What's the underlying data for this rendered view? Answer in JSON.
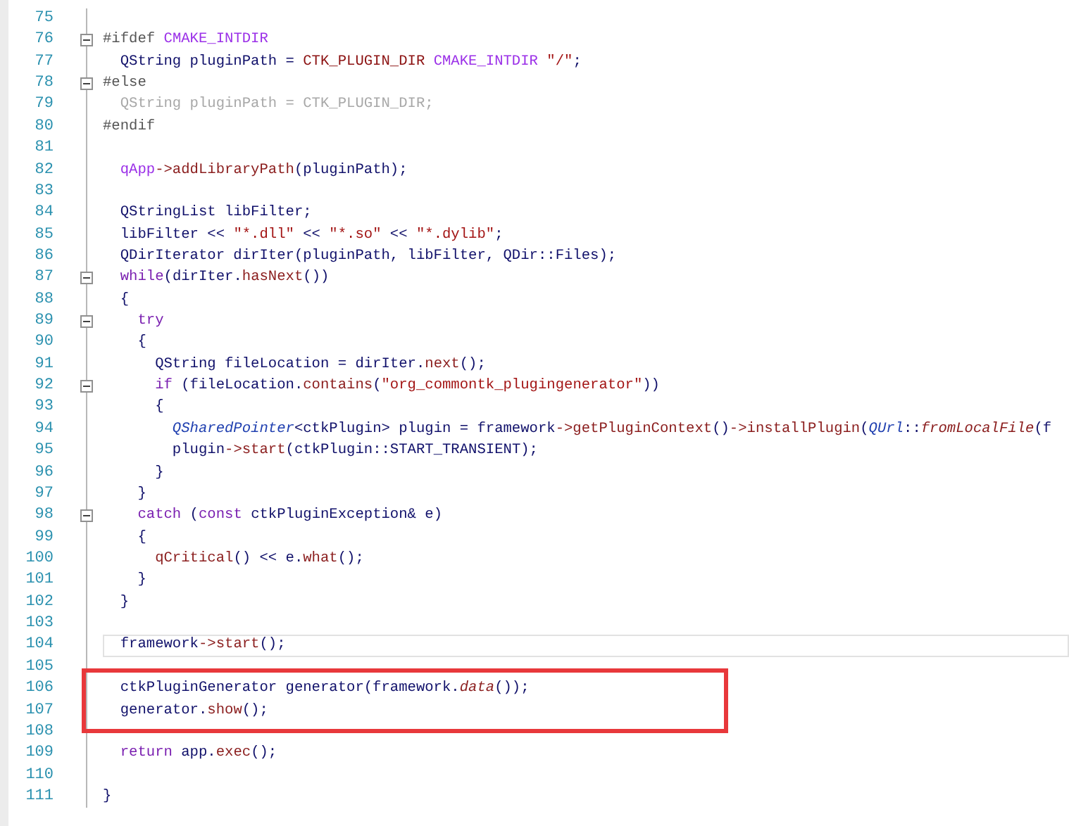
{
  "editor": {
    "lines": [
      {
        "number": "75",
        "collapsible": false,
        "current": false,
        "boxed": false
      },
      {
        "number": "76",
        "collapsible": true,
        "current": false,
        "boxed": false,
        "tokens": [
          {
            "kind": "preproc",
            "text": "#ifdef "
          },
          {
            "kind": "macro",
            "text": "CMAKE_INTDIR"
          }
        ]
      },
      {
        "number": "77",
        "collapsible": false,
        "current": false,
        "boxed": false,
        "tokens": [
          {
            "kind": "plain",
            "text": "  QString pluginPath = "
          },
          {
            "kind": "constant",
            "text": "CTK_PLUGIN_DIR "
          },
          {
            "kind": "macro",
            "text": "CMAKE_INTDIR "
          },
          {
            "kind": "string",
            "text": "\"/\""
          },
          {
            "kind": "plain",
            "text": ";"
          }
        ]
      },
      {
        "number": "78",
        "collapsible": true,
        "current": false,
        "boxed": false,
        "tokens": [
          {
            "kind": "preproc",
            "text": "#else"
          }
        ]
      },
      {
        "number": "79",
        "collapsible": false,
        "current": false,
        "boxed": false,
        "tokens": [
          {
            "kind": "inactive",
            "text": "  QString pluginPath = CTK_PLUGIN_DIR;"
          }
        ]
      },
      {
        "number": "80",
        "collapsible": false,
        "current": false,
        "boxed": false,
        "tokens": [
          {
            "kind": "preproc",
            "text": "#endif"
          }
        ]
      },
      {
        "number": "81",
        "collapsible": false,
        "current": false,
        "boxed": false
      },
      {
        "number": "82",
        "collapsible": false,
        "current": false,
        "boxed": false,
        "tokens": [
          {
            "kind": "macro",
            "text": "  qApp"
          },
          {
            "kind": "function",
            "text": "->addLibraryPath"
          },
          {
            "kind": "plain",
            "text": "(pluginPath);"
          }
        ]
      },
      {
        "number": "83",
        "collapsible": false,
        "current": false,
        "boxed": false
      },
      {
        "number": "84",
        "collapsible": false,
        "current": false,
        "boxed": false,
        "tokens": [
          {
            "kind": "plain",
            "text": "  QStringList libFilter;"
          }
        ]
      },
      {
        "number": "85",
        "collapsible": false,
        "current": false,
        "boxed": false,
        "tokens": [
          {
            "kind": "plain",
            "text": "  libFilter << "
          },
          {
            "kind": "string",
            "text": "\"*.dll\""
          },
          {
            "kind": "plain",
            "text": " << "
          },
          {
            "kind": "string",
            "text": "\"*.so\""
          },
          {
            "kind": "plain",
            "text": " << "
          },
          {
            "kind": "string",
            "text": "\"*.dylib\""
          },
          {
            "kind": "plain",
            "text": ";"
          }
        ]
      },
      {
        "number": "86",
        "collapsible": false,
        "current": false,
        "boxed": false,
        "tokens": [
          {
            "kind": "plain",
            "text": "  QDirIterator dirIter(pluginPath, libFilter, QDir::Files);"
          }
        ]
      },
      {
        "number": "87",
        "collapsible": true,
        "current": false,
        "boxed": false,
        "tokens": [
          {
            "kind": "keyword",
            "text": "  while"
          },
          {
            "kind": "plain",
            "text": "(dirIter."
          },
          {
            "kind": "function",
            "text": "hasNext"
          },
          {
            "kind": "plain",
            "text": "())"
          }
        ]
      },
      {
        "number": "88",
        "collapsible": false,
        "current": false,
        "boxed": false,
        "tokens": [
          {
            "kind": "plain",
            "text": "  {"
          }
        ]
      },
      {
        "number": "89",
        "collapsible": true,
        "current": false,
        "boxed": false,
        "tokens": [
          {
            "kind": "keyword",
            "text": "    try"
          }
        ]
      },
      {
        "number": "90",
        "collapsible": false,
        "current": false,
        "boxed": false,
        "tokens": [
          {
            "kind": "plain",
            "text": "    {"
          }
        ]
      },
      {
        "number": "91",
        "collapsible": false,
        "current": false,
        "boxed": false,
        "tokens": [
          {
            "kind": "plain",
            "text": "      QString fileLocation = dirIter."
          },
          {
            "kind": "function",
            "text": "next"
          },
          {
            "kind": "plain",
            "text": "();"
          }
        ]
      },
      {
        "number": "92",
        "collapsible": true,
        "current": false,
        "boxed": false,
        "tokens": [
          {
            "kind": "keyword",
            "text": "      if"
          },
          {
            "kind": "plain",
            "text": " (fileLocation."
          },
          {
            "kind": "function",
            "text": "contains"
          },
          {
            "kind": "plain",
            "text": "("
          },
          {
            "kind": "string",
            "text": "\"org_commontk_plugingenerator\""
          },
          {
            "kind": "plain",
            "text": "))"
          }
        ]
      },
      {
        "number": "93",
        "collapsible": false,
        "current": false,
        "boxed": false,
        "tokens": [
          {
            "kind": "plain",
            "text": "      {"
          }
        ]
      },
      {
        "number": "94",
        "collapsible": false,
        "current": false,
        "boxed": false,
        "tokens": [
          {
            "kind": "type-italic",
            "text": "        QSharedPointer"
          },
          {
            "kind": "plain",
            "text": "<ctkPlugin> plugin = framework"
          },
          {
            "kind": "function",
            "text": "->getPluginContext"
          },
          {
            "kind": "plain",
            "text": "()"
          },
          {
            "kind": "function",
            "text": "->installPlugin"
          },
          {
            "kind": "plain",
            "text": "("
          },
          {
            "kind": "type-italic",
            "text": "QUrl"
          },
          {
            "kind": "plain",
            "text": "::"
          },
          {
            "kind": "function-italic",
            "text": "fromLocalFile"
          },
          {
            "kind": "plain",
            "text": "(f"
          }
        ]
      },
      {
        "number": "95",
        "collapsible": false,
        "current": false,
        "boxed": false,
        "tokens": [
          {
            "kind": "plain",
            "text": "        plugin"
          },
          {
            "kind": "function",
            "text": "->start"
          },
          {
            "kind": "plain",
            "text": "(ctkPlugin::START_TRANSIENT);"
          }
        ]
      },
      {
        "number": "96",
        "collapsible": false,
        "current": false,
        "boxed": false,
        "tokens": [
          {
            "kind": "plain",
            "text": "      }"
          }
        ]
      },
      {
        "number": "97",
        "collapsible": false,
        "current": false,
        "boxed": false,
        "tokens": [
          {
            "kind": "plain",
            "text": "    }"
          }
        ]
      },
      {
        "number": "98",
        "collapsible": true,
        "current": false,
        "boxed": false,
        "tokens": [
          {
            "kind": "keyword",
            "text": "    catch"
          },
          {
            "kind": "plain",
            "text": " ("
          },
          {
            "kind": "keyword",
            "text": "const"
          },
          {
            "kind": "plain",
            "text": " ctkPluginException& e)"
          }
        ]
      },
      {
        "number": "99",
        "collapsible": false,
        "current": false,
        "boxed": false,
        "tokens": [
          {
            "kind": "plain",
            "text": "    {"
          }
        ]
      },
      {
        "number": "100",
        "collapsible": false,
        "current": false,
        "boxed": false,
        "tokens": [
          {
            "kind": "function",
            "text": "      qCritical"
          },
          {
            "kind": "plain",
            "text": "() << e."
          },
          {
            "kind": "function",
            "text": "what"
          },
          {
            "kind": "plain",
            "text": "();"
          }
        ]
      },
      {
        "number": "101",
        "collapsible": false,
        "current": false,
        "boxed": false,
        "tokens": [
          {
            "kind": "plain",
            "text": "    }"
          }
        ]
      },
      {
        "number": "102",
        "collapsible": false,
        "current": false,
        "boxed": false,
        "tokens": [
          {
            "kind": "plain",
            "text": "  }"
          }
        ]
      },
      {
        "number": "103",
        "collapsible": false,
        "current": false,
        "boxed": false
      },
      {
        "number": "104",
        "collapsible": false,
        "current": true,
        "boxed": false,
        "tokens": [
          {
            "kind": "plain",
            "text": "  framework"
          },
          {
            "kind": "function",
            "text": "->start"
          },
          {
            "kind": "plain",
            "text": "();"
          }
        ]
      },
      {
        "number": "105",
        "collapsible": false,
        "current": false,
        "boxed": false
      },
      {
        "number": "106",
        "collapsible": false,
        "current": false,
        "boxed": true,
        "tokens": [
          {
            "kind": "plain",
            "text": "  ctkPluginGenerator generator(framework."
          },
          {
            "kind": "function-italic",
            "text": "data"
          },
          {
            "kind": "plain",
            "text": "());"
          }
        ]
      },
      {
        "number": "107",
        "collapsible": false,
        "current": false,
        "boxed": true,
        "tokens": [
          {
            "kind": "plain",
            "text": "  generator."
          },
          {
            "kind": "function",
            "text": "show"
          },
          {
            "kind": "plain",
            "text": "();"
          }
        ]
      },
      {
        "number": "108",
        "collapsible": false,
        "current": false,
        "boxed": false
      },
      {
        "number": "109",
        "collapsible": false,
        "current": false,
        "boxed": false,
        "tokens": [
          {
            "kind": "keyword",
            "text": "  return"
          },
          {
            "kind": "plain",
            "text": " app."
          },
          {
            "kind": "function",
            "text": "exec"
          },
          {
            "kind": "plain",
            "text": "();"
          }
        ]
      },
      {
        "number": "110",
        "collapsible": false,
        "current": false,
        "boxed": false
      },
      {
        "number": "111",
        "collapsible": false,
        "current": false,
        "boxed": false,
        "tokens": [
          {
            "kind": "plain",
            "text": "}"
          }
        ]
      }
    ]
  }
}
